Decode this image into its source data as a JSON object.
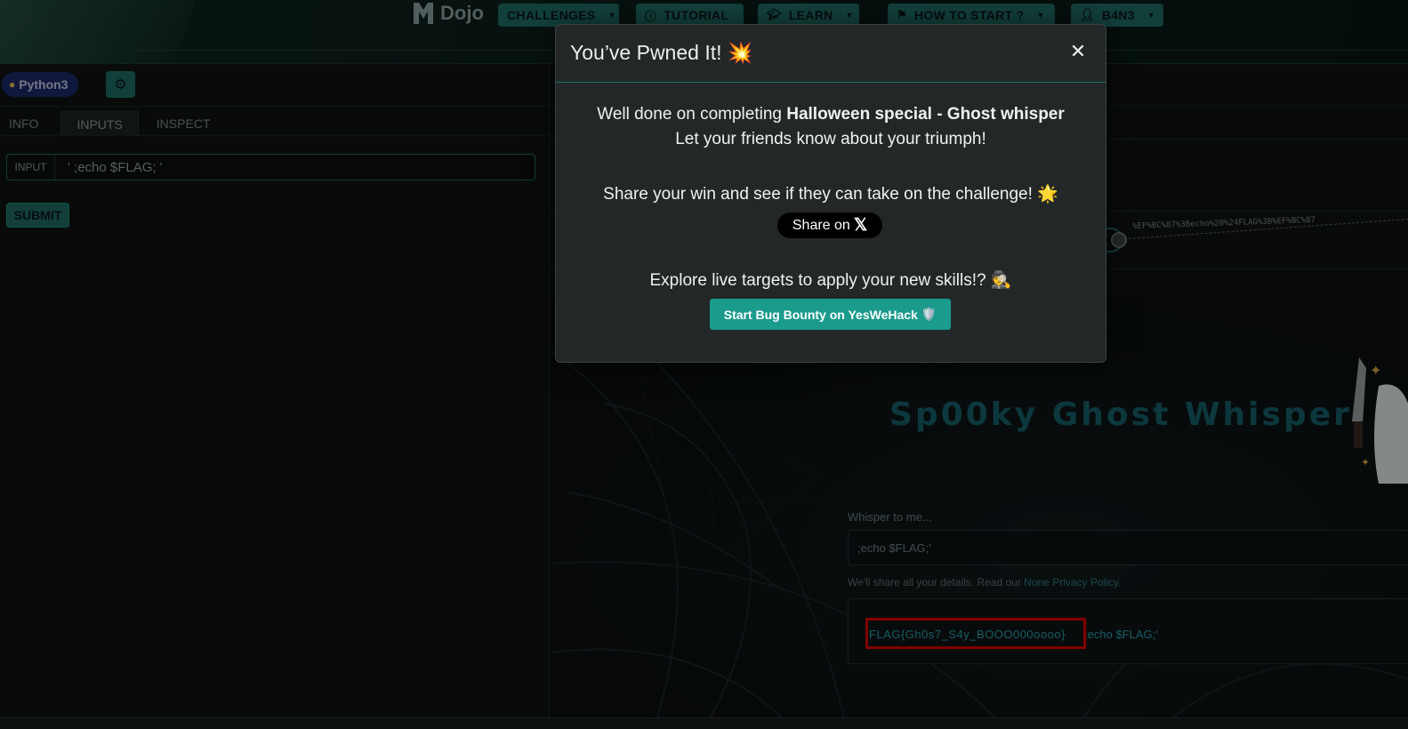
{
  "nav": {
    "brand": "Dojo",
    "challenges": "CHALLENGES",
    "tutorial": "TUTORIAL",
    "learn": "LEARN",
    "how_to_start": "HOW TO START ?",
    "user": "B4N3"
  },
  "editor": {
    "language": "Python3",
    "tabs": [
      "INFO",
      "INPUTS",
      "INSPECT"
    ],
    "input_label": "INPUT",
    "input_value": "' ;echo $FLAG; '",
    "submit": "SUBMIT",
    "flow_url": "%EF%BC%87%3Becho%20%24FLAG%3B%EF%BC%87"
  },
  "preview": {
    "site_title": "Sp00ky Ghost Whisper",
    "whisper_label": "Whisper to me...",
    "whisper_value": ";echo $FLAG;'",
    "privacy_prefix": "We'll share all your details. Read our ",
    "privacy_link": "None Privacy Policy",
    "privacy_suffix": ".",
    "flag_output": "FLAG{Gh0s7_S4y_BOOO000oooo}",
    "echo_output": ";echo $FLAG;'",
    "highlight_color": "#e00000"
  },
  "modal": {
    "title": "You’ve Pwned It! 💥",
    "line1_prefix": "Well done on completing ",
    "challenge_name": "Halloween special - Ghost whisper",
    "line2": "Let your friends know about your triumph!",
    "line3": "Share your win and see if they can take on the challenge! 🌟",
    "share_label": "Share on",
    "share_logo": "𝕏",
    "line4": "Explore live targets to apply your new skills!? 🕵️",
    "bounty_label": "Start Bug Bounty on YesWeHack",
    "bounty_icon": "🛡️",
    "close_symbol": "✕"
  },
  "colors": {
    "accent": "#1f6d64",
    "bounty": "#1a9b8c",
    "flag_text": "#2ba0b0"
  }
}
